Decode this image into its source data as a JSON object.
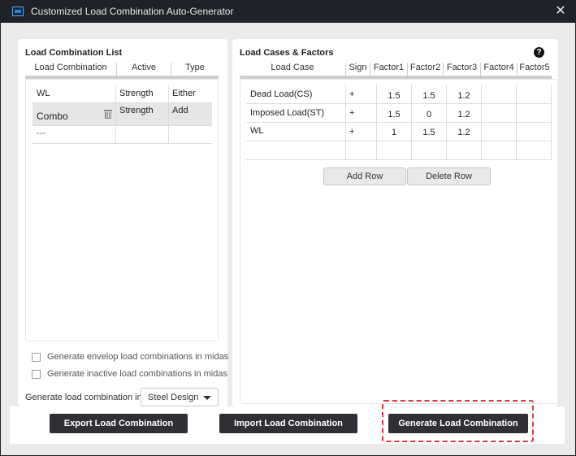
{
  "window": {
    "title": "Customized Load Combination Auto-Generator",
    "close_glyph": "✕"
  },
  "left_panel": {
    "title": "Load Combination List",
    "columns": [
      "Load Combination",
      "Active",
      "Type"
    ],
    "rows": [
      {
        "name": "WL",
        "active": "Strength",
        "type": "Either"
      },
      {
        "name": "Combo",
        "active": "Strength",
        "type": "Add"
      },
      {
        "name": "---",
        "active": "",
        "type": ""
      }
    ],
    "checkbox_envelope": "Generate envelop load combinations in midas",
    "checkbox_inactive": "Generate inactive load combinations in midas",
    "generate_in_label": "Generate load combination in:",
    "generate_in_value": "Steel Design"
  },
  "right_panel": {
    "title": "Load Cases & Factors",
    "help_glyph": "?",
    "columns": [
      "Load Case",
      "Sign",
      "Factor1",
      "Factor2",
      "Factor3",
      "Factor4",
      "Factor5"
    ],
    "rows": [
      {
        "case": "Dead Load(CS)",
        "sign": "+",
        "f1": "1.5",
        "f2": "1.5",
        "f3": "1.2",
        "f4": "",
        "f5": ""
      },
      {
        "case": "Imposed Load(ST)",
        "sign": "+",
        "f1": "1.5",
        "f2": "0",
        "f3": "1.2",
        "f4": "",
        "f5": ""
      },
      {
        "case": "WL",
        "sign": "+",
        "f1": "1",
        "f2": "1.5",
        "f3": "1.2",
        "f4": "",
        "f5": ""
      }
    ],
    "add_row_label": "Add Row",
    "delete_row_label": "Delete Row"
  },
  "footer": {
    "export_label": "Export Load Combination",
    "import_label": "Import Load Combination",
    "generate_label": "Generate Load Combination"
  },
  "colors": {
    "titlebar": "#1f2228",
    "background": "#ebebeb",
    "dark_button": "#2e3035",
    "highlight": "#e0363c"
  },
  "icons": [
    "app-icon",
    "close-icon",
    "trash-icon",
    "help-icon",
    "chevron-down-icon"
  ]
}
